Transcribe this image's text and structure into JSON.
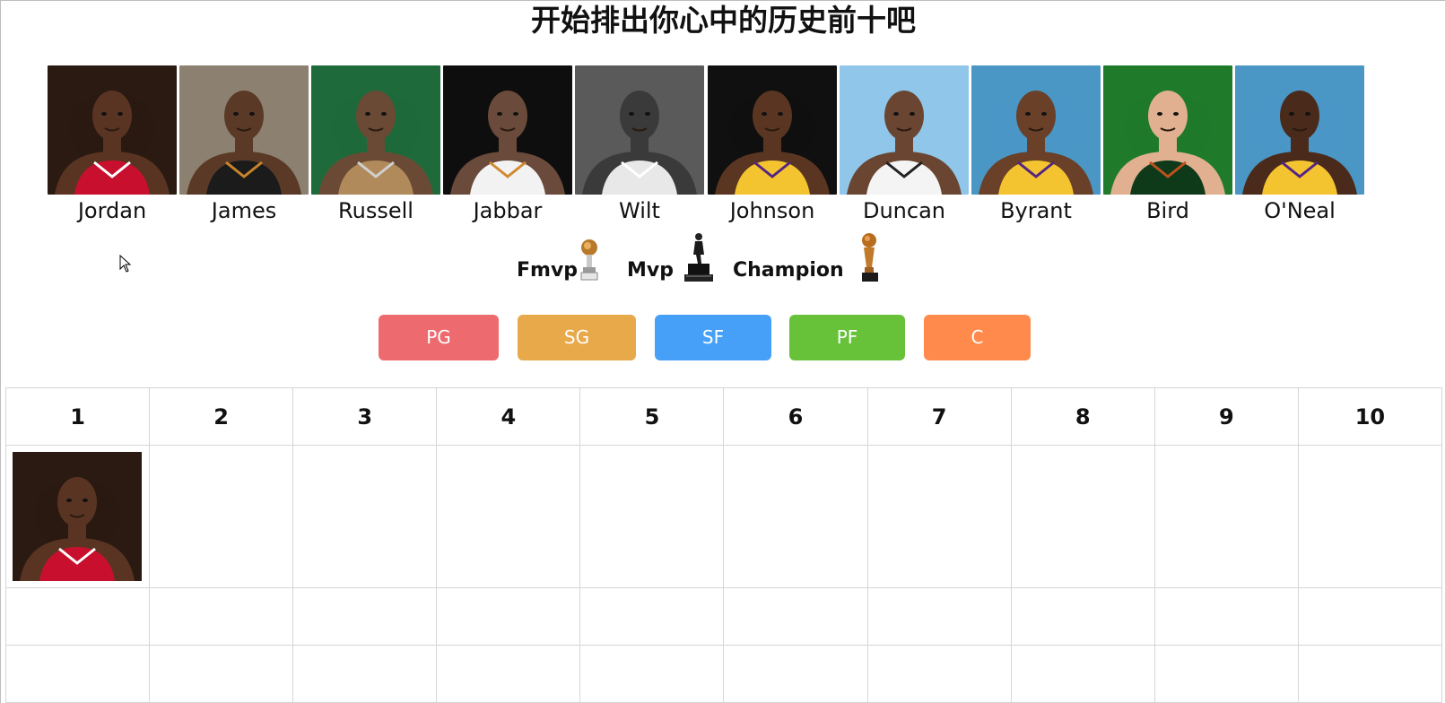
{
  "title": "开始排出你心中的历史前十吧",
  "players": [
    {
      "name": "Jordan",
      "palette": {
        "bg": "#2a1a12",
        "skin": "#5a3422",
        "jersey": "#c8102e",
        "accent": "#ffffff"
      }
    },
    {
      "name": "James",
      "palette": {
        "bg": "#8c8070",
        "skin": "#5a3a26",
        "jersey": "#1b1b1b",
        "accent": "#c8842a"
      }
    },
    {
      "name": "Russell",
      "palette": {
        "bg": "#1f6a3a",
        "skin": "#6a4a34",
        "jersey": "#b08a5a",
        "accent": "#d0d0d0"
      }
    },
    {
      "name": "Jabbar",
      "palette": {
        "bg": "#0e0e0e",
        "skin": "#6a4a3a",
        "jersey": "#f2f2f2",
        "accent": "#d08a30"
      }
    },
    {
      "name": "Wilt",
      "palette": {
        "bg": "#5a5a5a",
        "skin": "#3a3a3a",
        "jersey": "#e8e8e8",
        "accent": "#ffffff"
      }
    },
    {
      "name": "Johnson",
      "palette": {
        "bg": "#101010",
        "skin": "#5a3622",
        "jersey": "#f4c430",
        "accent": "#552583"
      }
    },
    {
      "name": "Duncan",
      "palette": {
        "bg": "#8fc6ea",
        "skin": "#6a4632",
        "jersey": "#f4f4f4",
        "accent": "#222222"
      }
    },
    {
      "name": "Byrant",
      "palette": {
        "bg": "#4a97c6",
        "skin": "#6a4028",
        "jersey": "#f4c430",
        "accent": "#552583"
      }
    },
    {
      "name": "Bird",
      "palette": {
        "bg": "#1f7a2a",
        "skin": "#e0b090",
        "jersey": "#0e3a1a",
        "accent": "#c0501e"
      }
    },
    {
      "name": "O'Neal",
      "palette": {
        "bg": "#4a97c6",
        "skin": "#4a2a1a",
        "jersey": "#f4c430",
        "accent": "#552583"
      }
    }
  ],
  "awards": [
    {
      "label": "Fmvp",
      "icon": "fmvp-trophy-icon"
    },
    {
      "label": "Mvp",
      "icon": "mvp-trophy-icon"
    },
    {
      "label": "Champion",
      "icon": "championship-trophy-icon"
    }
  ],
  "positions": [
    {
      "label": "PG",
      "color": "#ed6a6e"
    },
    {
      "label": "SG",
      "color": "#e8a94a"
    },
    {
      "label": "SF",
      "color": "#46a0f7"
    },
    {
      "label": "PF",
      "color": "#67c23a"
    },
    {
      "label": "C",
      "color": "#ff8a4c"
    }
  ],
  "ranking": {
    "headers": [
      "1",
      "2",
      "3",
      "4",
      "5",
      "6",
      "7",
      "8",
      "9",
      "10"
    ],
    "placed": [
      {
        "rank": "1",
        "player": "Jordan"
      }
    ]
  }
}
